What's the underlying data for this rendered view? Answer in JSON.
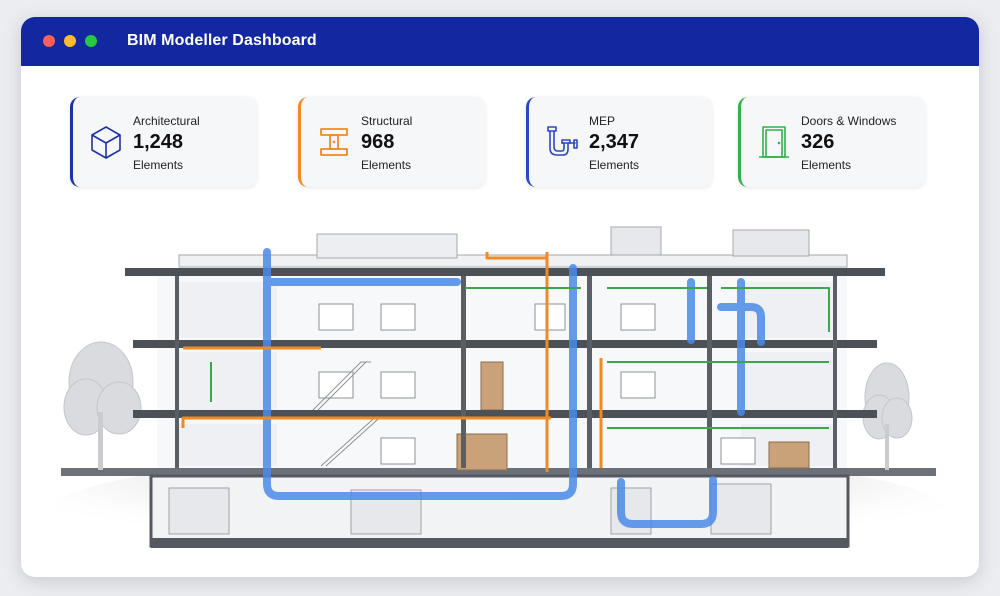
{
  "window": {
    "title": "BIM Modeller Dashboard"
  },
  "colors": {
    "titlebar": "#1328a0",
    "architectural": "#1d32a8",
    "structural": "#f08a24",
    "mep": "#2b46c8",
    "doors_windows": "#2fb34a",
    "duct_blue": "#4b8ae8",
    "pipe_orange": "#f08a24",
    "pipe_green": "#3aa84a"
  },
  "cards": [
    {
      "label": "Architectural",
      "value": "1,248",
      "unit": "Elements",
      "icon": "cube-icon"
    },
    {
      "label": "Structural",
      "value": "968",
      "unit": "Elements",
      "icon": "i-beam-icon"
    },
    {
      "label": "MEP",
      "value": "2,347",
      "unit": "Elements",
      "icon": "pipe-icon"
    },
    {
      "label": "Doors & Windows",
      "value": "326",
      "unit": "Elements",
      "icon": "door-icon"
    }
  ]
}
